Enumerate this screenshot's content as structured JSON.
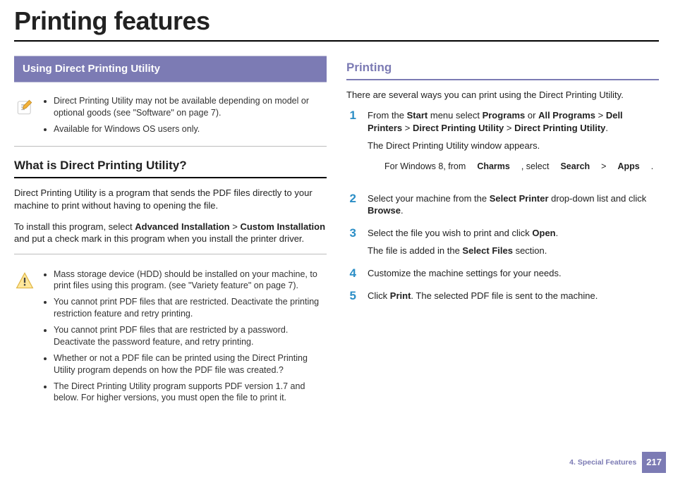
{
  "title": "Printing features",
  "left": {
    "sectionBar": "Using Direct Printing Utility",
    "note1": [
      "Direct Printing Utility may not be available depending on model or optional goods (see \"Software\" on page 7).",
      "Available for Windows OS users only."
    ],
    "h2_what": "What is Direct Printing Utility?",
    "p_what": "Direct Printing Utility is a program that sends the PDF files directly to your machine to print without having to opening the file.",
    "p_install_pre": "To install this program, select ",
    "p_install_b1": "Advanced Installation",
    "p_install_gt": " > ",
    "p_install_b2": "Custom Installation",
    "p_install_post": " and put a check mark in this program when you install the printer driver.",
    "warn": [
      "Mass storage device (HDD) should be installed on your machine, to print files using this program. (see \"Variety feature\" on page 7).",
      "You cannot print PDF files that are restricted. Deactivate the printing restriction feature and retry printing.",
      "You cannot print PDF files that are restricted by a password. Deactivate the password feature, and retry printing.",
      "Whether or not a PDF file can be printed using the Direct Printing Utility program depends on how the PDF file was created.?",
      "The Direct Printing Utility program supports PDF version 1.7 and below. For higher versions, you must open the file to print it."
    ]
  },
  "right": {
    "h2_printing": "Printing",
    "p_intro": "There are several ways you can print using the Direct Printing Utility.",
    "steps": {
      "s1_pre": "From the ",
      "s1_b_start": "Start",
      "s1_mid1": " menu select ",
      "s1_b_programs": "Programs",
      "s1_or": " or ",
      "s1_b_allprograms": "All Programs",
      "s1_gt1": " > ",
      "s1_b_dell": "Dell Printers",
      "s1_gt2": " > ",
      "s1_b_dpu1": "Direct Printing Utility",
      "s1_gt3": " > ",
      "s1_b_dpu2": "Direct Printing Utility",
      "s1_period": ".",
      "s1_line2": "The Direct Printing Utility window appears.",
      "s1_sub_pre": "For Windows 8, from ",
      "s1_sub_b_charms": "Charms",
      "s1_sub_mid": ", select ",
      "s1_sub_b_search": "Search",
      "s1_sub_gt": " > ",
      "s1_sub_b_apps": "Apps",
      "s1_sub_period": ".",
      "s2_pre": "Select your machine from the ",
      "s2_b_selprinter": "Select Printer",
      "s2_mid": " drop-down list and click ",
      "s2_b_browse": "Browse",
      "s2_period": ".",
      "s3_pre": "Select the file you wish to print and click ",
      "s3_b_open": "Open",
      "s3_period": ".",
      "s3_line2_pre": "The file is added in the ",
      "s3_line2_b": "Select Files",
      "s3_line2_post": " section.",
      "s4": "Customize the machine settings for your needs.",
      "s5_pre": "Click ",
      "s5_b_print": "Print",
      "s5_post": ". The selected PDF file is sent to the machine."
    }
  },
  "footer": {
    "chapter": "4.  Special Features",
    "page": "217"
  },
  "nums": {
    "n1": "1",
    "n2": "2",
    "n3": "3",
    "n4": "4",
    "n5": "5"
  }
}
